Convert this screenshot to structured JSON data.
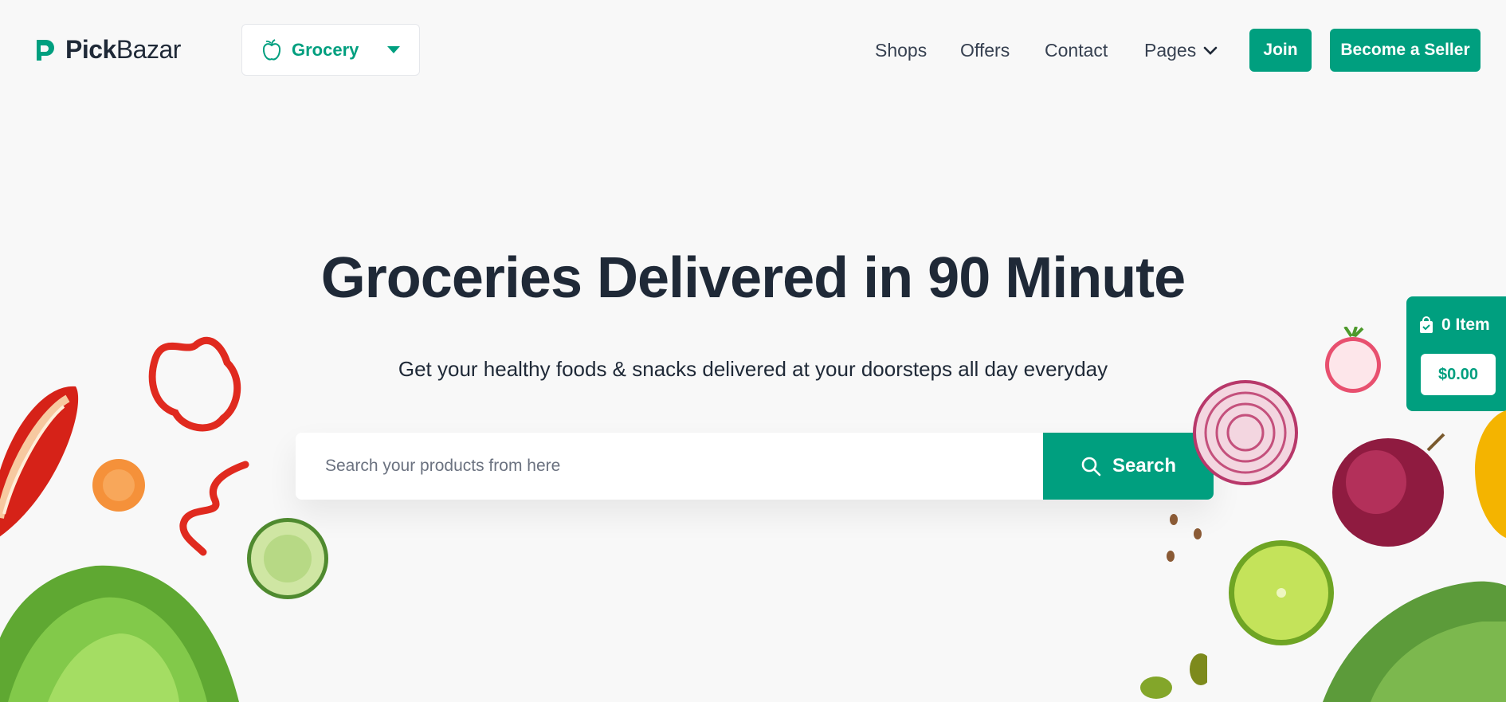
{
  "brand": {
    "name_part1": "Pick",
    "name_part2": "Bazar",
    "accent": "#009f7f"
  },
  "type_selector": {
    "label": "Grocery",
    "icon": "apple-icon"
  },
  "nav": {
    "items": [
      "Shops",
      "Offers",
      "Contact",
      "Pages"
    ],
    "join_label": "Join",
    "seller_label": "Become a Seller"
  },
  "hero": {
    "title": "Groceries Delivered in 90 Minute",
    "subtitle": "Get your healthy foods & snacks delivered at your doorsteps all day everyday"
  },
  "search": {
    "placeholder": "Search your products from here",
    "button_label": "Search"
  },
  "cart": {
    "count_label": "0 Item",
    "total": "$0.00"
  }
}
